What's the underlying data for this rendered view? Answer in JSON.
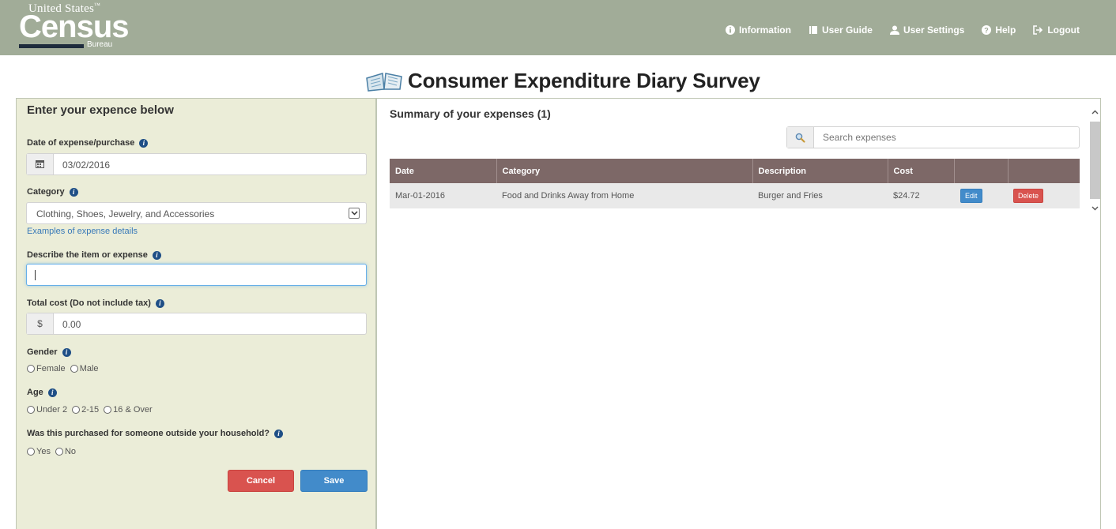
{
  "logo": {
    "top_text": "United States",
    "tm": "™",
    "main": "Census",
    "sub": "Bureau"
  },
  "nav": [
    {
      "icon": "info-circle-icon",
      "label": "Information"
    },
    {
      "icon": "book-icon",
      "label": "User Guide"
    },
    {
      "icon": "user-icon",
      "label": "User Settings"
    },
    {
      "icon": "question-circle-icon",
      "label": "Help"
    },
    {
      "icon": "logout-icon",
      "label": "Logout"
    }
  ],
  "page_title": "Consumer Expenditure Diary Survey",
  "form": {
    "heading": "Enter your expence below",
    "date_label": "Date of expense/purchase",
    "date_value": "03/02/2016",
    "category_label": "Category",
    "category_value": "Clothing, Shoes, Jewelry, and Accessories",
    "examples_link": "Examples of expense details",
    "describe_label": "Describe the item or expense",
    "describe_value": "",
    "cost_label": "Total cost (Do not include tax)",
    "currency": "$",
    "cost_value": "0.00",
    "gender_label": "Gender",
    "gender_options": [
      "Female",
      "Male"
    ],
    "age_label": "Age",
    "age_options": [
      "Under 2",
      "2-15",
      "16 & Over"
    ],
    "outside_label": "Was this purchased for someone outside your household?",
    "outside_options": [
      "Yes",
      "No"
    ],
    "cancel": "Cancel",
    "save": "Save"
  },
  "summary": {
    "heading": "Summary of your expenses (1)",
    "search_placeholder": "Search expenses",
    "columns": [
      "Date",
      "Category",
      "Description",
      "Cost",
      "",
      ""
    ],
    "rows": [
      {
        "date": "Mar-01-2016",
        "category": "Food and Drinks Away from Home",
        "description": "Burger and Fries",
        "cost": "$24.72",
        "edit": "Edit",
        "delete": "Delete"
      }
    ]
  },
  "colors": {
    "header_bg": "#a1ac98",
    "form_bg": "#ebedd8",
    "table_header": "#7d6867",
    "primary": "#428bca",
    "danger": "#d9534f"
  }
}
